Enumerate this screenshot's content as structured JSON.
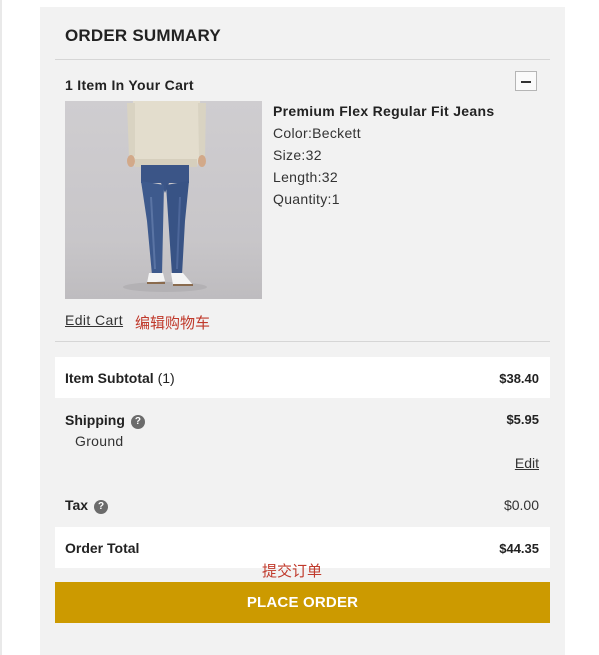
{
  "summary": {
    "title": "ORDER SUMMARY",
    "cart_count_label": "1 Item In Your Cart",
    "collapse_icon": "minus-icon"
  },
  "product": {
    "name": "Premium Flex Regular Fit Jeans",
    "color": "Color:Beckett",
    "size": "Size:32",
    "length": "Length:32",
    "quantity": "Quantity:1",
    "edit_cart_label": "Edit Cart"
  },
  "totals": {
    "subtotal_label": "Item Subtotal",
    "subtotal_count": "(1)",
    "subtotal_value": "$38.40",
    "shipping_label": "Shipping",
    "shipping_value": "$5.95",
    "shipping_method": "Ground",
    "shipping_edit_label": "Edit",
    "tax_label": "Tax",
    "tax_value": "$0.00",
    "help_icon": "?",
    "order_total_label": "Order Total",
    "order_total_value": "$44.35"
  },
  "actions": {
    "place_order_label": "PLACE ORDER"
  },
  "annotations": {
    "edit_cart_note": "编辑购物车",
    "place_order_note": "提交订单"
  },
  "colors": {
    "panel_bg": "#f2f2f2",
    "row_bg": "#ffffff",
    "place_order_bg": "#cc9a00",
    "annotation_red": "#c0392b"
  }
}
